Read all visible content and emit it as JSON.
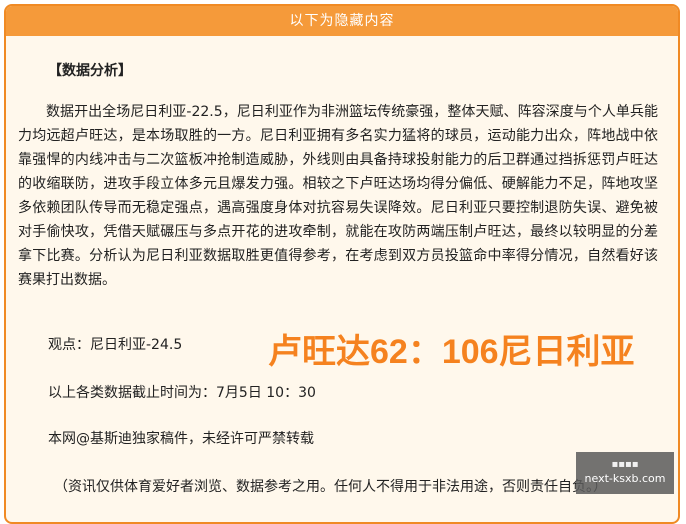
{
  "header": {
    "title": "以下为隐藏内容"
  },
  "article": {
    "section_title": "【数据分析】",
    "analysis": "数据开出全场尼日利亚-22.5，尼日利亚作为非洲篮坛传统豪强，整体天赋、阵容深度与个人单兵能力均远超卢旺达，是本场取胜的一方。尼日利亚拥有多名实力猛将的球员，运动能力出众，阵地战中依靠强悍的内线冲击与二次篮板冲抢制造威胁，外线则由具备持球投射能力的后卫群通过挡拆惩罚卢旺达的收缩联防，进攻手段立体多元且爆发力强。相较之下卢旺达场均得分偏低、硬解能力不足，阵地攻坚多依赖团队传导而无稳定强点，遇高强度身体对抗容易失误降效。尼日利亚只要控制退防失误、避免被对手偷快攻，凭借天赋碾压与多点开花的进攻牵制，就能在攻防两端压制卢旺达，最终以较明显的分差拿下比赛。分析认为尼日利亚数据取胜更值得参考，在考虑到双方员投篮命中率得分情况，自然看好该赛果打出数据。",
    "viewpoint": "观点：尼日利亚-24.5",
    "score_overlay": "卢旺达62：106尼日利亚",
    "cutoff_time": "以上各类数据截止时间为：7月5日 10：30",
    "copyright": "本网@基斯迪独家稿件，未经许可严禁转载",
    "disclaimer": "（资讯仅供体育爱好者浏览、数据参考之用。任何人不得用于非法用途，否则责任自负。）"
  },
  "watermark": {
    "logo_text": "▪▪▪▪",
    "site": "next-ksxb.com"
  },
  "colors": {
    "accent": "#f59a3a",
    "border": "#f08a24",
    "background": "#fff8ec",
    "score": "#f5821f"
  }
}
